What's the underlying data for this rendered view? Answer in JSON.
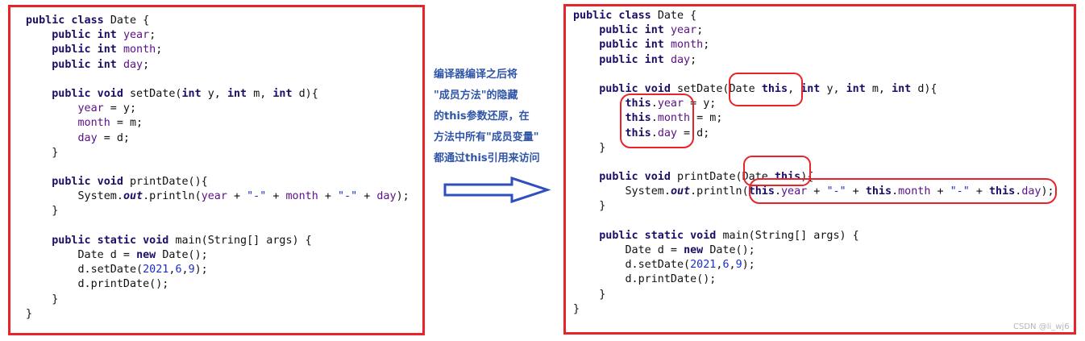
{
  "note": {
    "lines": [
      "编译器编译之后将",
      "\"成员方法\"的隐藏",
      "的this参数还原，在",
      "方法中所有\"成员变量\"",
      "都通过this引用来访问"
    ]
  },
  "code_before": [
    [
      [
        "k",
        "public class "
      ],
      [
        "p",
        "Date {"
      ]
    ],
    [
      [
        "p",
        "    "
      ],
      [
        "k",
        "public int "
      ],
      [
        "f",
        "year"
      ],
      [
        "p",
        ";"
      ]
    ],
    [
      [
        "p",
        "    "
      ],
      [
        "k",
        "public int "
      ],
      [
        "f",
        "month"
      ],
      [
        "p",
        ";"
      ]
    ],
    [
      [
        "p",
        "    "
      ],
      [
        "k",
        "public int "
      ],
      [
        "f",
        "day"
      ],
      [
        "p",
        ";"
      ]
    ],
    [],
    [
      [
        "p",
        "    "
      ],
      [
        "k",
        "public void "
      ],
      [
        "p",
        "setDate("
      ],
      [
        "k",
        "int "
      ],
      [
        "p",
        "y, "
      ],
      [
        "k",
        "int "
      ],
      [
        "p",
        "m, "
      ],
      [
        "k",
        "int "
      ],
      [
        "p",
        "d){"
      ]
    ],
    [
      [
        "p",
        "        "
      ],
      [
        "f",
        "year"
      ],
      [
        "p",
        " = y;"
      ]
    ],
    [
      [
        "p",
        "        "
      ],
      [
        "f",
        "month"
      ],
      [
        "p",
        " = m;"
      ]
    ],
    [
      [
        "p",
        "        "
      ],
      [
        "f",
        "day"
      ],
      [
        "p",
        " = d;"
      ]
    ],
    [
      [
        "p",
        "    }"
      ]
    ],
    [],
    [
      [
        "p",
        "    "
      ],
      [
        "k",
        "public void "
      ],
      [
        "p",
        "printDate(){"
      ]
    ],
    [
      [
        "p",
        "        System."
      ],
      [
        "o",
        "out"
      ],
      [
        "p",
        ".println("
      ],
      [
        "f",
        "year"
      ],
      [
        "p",
        " + "
      ],
      [
        "s",
        "\"-\""
      ],
      [
        "p",
        " + "
      ],
      [
        "f",
        "month"
      ],
      [
        "p",
        " + "
      ],
      [
        "s",
        "\"-\""
      ],
      [
        "p",
        " + "
      ],
      [
        "f",
        "day"
      ],
      [
        "p",
        ");"
      ]
    ],
    [
      [
        "p",
        "    }"
      ]
    ],
    [],
    [
      [
        "p",
        "    "
      ],
      [
        "k",
        "public static void "
      ],
      [
        "p",
        "main(String[] args) {"
      ]
    ],
    [
      [
        "p",
        "        Date d = "
      ],
      [
        "k",
        "new "
      ],
      [
        "p",
        "Date();"
      ]
    ],
    [
      [
        "p",
        "        d.setDate("
      ],
      [
        "n",
        "2021"
      ],
      [
        "p",
        ","
      ],
      [
        "n",
        "6"
      ],
      [
        "p",
        ","
      ],
      [
        "n",
        "9"
      ],
      [
        "p",
        ");"
      ]
    ],
    [
      [
        "p",
        "        d.printDate();"
      ]
    ],
    [
      [
        "p",
        "    }"
      ]
    ],
    [
      [
        "p",
        "}"
      ]
    ]
  ],
  "code_after": [
    [
      [
        "k",
        "public class "
      ],
      [
        "p",
        "Date {"
      ]
    ],
    [
      [
        "p",
        "    "
      ],
      [
        "k",
        "public int "
      ],
      [
        "f",
        "year"
      ],
      [
        "p",
        ";"
      ]
    ],
    [
      [
        "p",
        "    "
      ],
      [
        "k",
        "public int "
      ],
      [
        "f",
        "month"
      ],
      [
        "p",
        ";"
      ]
    ],
    [
      [
        "p",
        "    "
      ],
      [
        "k",
        "public int "
      ],
      [
        "f",
        "day"
      ],
      [
        "p",
        ";"
      ]
    ],
    [],
    [
      [
        "p",
        "    "
      ],
      [
        "k",
        "public void "
      ],
      [
        "p",
        "setDate(Date "
      ],
      [
        "k",
        "this"
      ],
      [
        "p",
        ", "
      ],
      [
        "k",
        "int "
      ],
      [
        "p",
        "y, "
      ],
      [
        "k",
        "int "
      ],
      [
        "p",
        "m, "
      ],
      [
        "k",
        "int "
      ],
      [
        "p",
        "d){"
      ]
    ],
    [
      [
        "p",
        "        "
      ],
      [
        "k",
        "this"
      ],
      [
        "p",
        "."
      ],
      [
        "f",
        "year"
      ],
      [
        "p",
        " = y;"
      ]
    ],
    [
      [
        "p",
        "        "
      ],
      [
        "k",
        "this"
      ],
      [
        "p",
        "."
      ],
      [
        "f",
        "month"
      ],
      [
        "p",
        " = m;"
      ]
    ],
    [
      [
        "p",
        "        "
      ],
      [
        "k",
        "this"
      ],
      [
        "p",
        "."
      ],
      [
        "f",
        "day"
      ],
      [
        "p",
        " = d;"
      ]
    ],
    [
      [
        "p",
        "    }"
      ]
    ],
    [],
    [
      [
        "p",
        "    "
      ],
      [
        "k",
        "public void "
      ],
      [
        "p",
        "printDate(Date "
      ],
      [
        "k",
        "this"
      ],
      [
        "p",
        "){"
      ]
    ],
    [
      [
        "p",
        "        System."
      ],
      [
        "o",
        "out"
      ],
      [
        "p",
        ".println("
      ],
      [
        "k",
        "this"
      ],
      [
        "p",
        "."
      ],
      [
        "f",
        "year"
      ],
      [
        "p",
        " + "
      ],
      [
        "s",
        "\"-\""
      ],
      [
        "p",
        " + "
      ],
      [
        "k",
        "this"
      ],
      [
        "p",
        "."
      ],
      [
        "f",
        "month"
      ],
      [
        "p",
        " + "
      ],
      [
        "s",
        "\"-\""
      ],
      [
        "p",
        " + "
      ],
      [
        "k",
        "this"
      ],
      [
        "p",
        "."
      ],
      [
        "f",
        "day"
      ],
      [
        "p",
        ");"
      ]
    ],
    [
      [
        "p",
        "    }"
      ]
    ],
    [],
    [
      [
        "p",
        "    "
      ],
      [
        "k",
        "public static void "
      ],
      [
        "p",
        "main(String[] args) {"
      ]
    ],
    [
      [
        "p",
        "        Date d = "
      ],
      [
        "k",
        "new "
      ],
      [
        "p",
        "Date();"
      ]
    ],
    [
      [
        "p",
        "        d.setDate("
      ],
      [
        "n",
        "2021"
      ],
      [
        "p",
        ","
      ],
      [
        "n",
        "6"
      ],
      [
        "p",
        ","
      ],
      [
        "n",
        "9"
      ],
      [
        "p",
        ");"
      ]
    ],
    [
      [
        "p",
        "        d.printDate();"
      ]
    ],
    [
      [
        "p",
        "    }"
      ]
    ],
    [
      [
        "p",
        "}"
      ]
    ]
  ],
  "watermark": "CSDN @li_wj6",
  "colors": {
    "frame": "#e8232a",
    "keyword": "#1a0f66",
    "field": "#5b0f88",
    "string": "#1a2ec8",
    "note": "#2f55a8",
    "arrow": "#2f4fbf",
    "highlight": "#e8232a"
  }
}
